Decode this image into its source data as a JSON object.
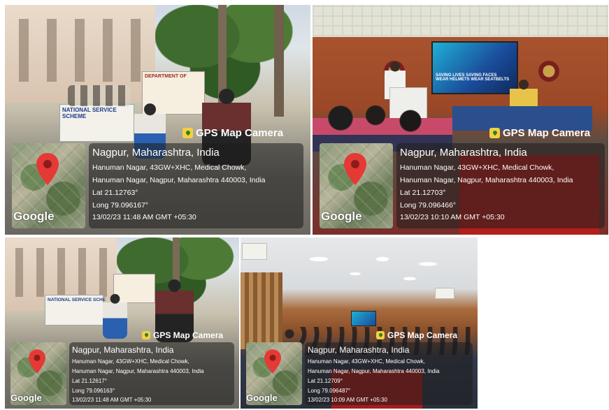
{
  "overlay_title": "GPS Map Camera",
  "google_label": "Google",
  "photos": [
    {
      "place": "Nagpur, Maharashtra, India",
      "address1": "Hanuman Nagar, 43GW+XHC, Medical Chowk,",
      "address2": "Hanuman Nagar, Nagpur, Maharashtra 440003, India",
      "lat": "Lat 21.12763°",
      "long": "Long 79.096167°",
      "datetime": "13/02/23 11:48 AM GMT +05:30",
      "banner_left": "NATIONAL SERVICE SCHEME",
      "banner_right": "DEPARTMENT OF"
    },
    {
      "place": "Nagpur, Maharashtra, India",
      "address1": "Hanuman Nagar, 43GW+XHC, Medical Chowk,",
      "address2": "Hanuman Nagar, Nagpur, Maharashtra 440003, India",
      "lat": "Lat 21.12703°",
      "long": "Long 79.096466°",
      "datetime": "13/02/23 10:10 AM GMT +05:30",
      "screen_line1": "SAVING LIVES  SAVING FACES",
      "screen_line2": "WEAR HELMETS  WEAR SEATBELTS"
    },
    {
      "place": "Nagpur, Maharashtra, India",
      "address1": "Hanuman Nagar, 43GW+XHC, Medical Chowk,",
      "address2": "Hanuman Nagar, Nagpur, Maharashtra 440003, India",
      "lat": "Lat 21.12617°",
      "long": "Long 79.096163°",
      "datetime": "13/02/23 11:48 AM GMT +05:30",
      "banner_left": "NATIONAL SERVICE SCHE"
    },
    {
      "place": "Nagpur, Maharashtra, India",
      "address1": "Hanuman Nagar, 43GW+XHC, Medical Chowk,",
      "address2": "Hanuman Nagar, Nagpur, Maharashtra 440003, India",
      "lat": "Lat 21.12709°",
      "long": "Long 79.096487°",
      "datetime": "13/02/23 10:09 AM GMT +05:30"
    }
  ]
}
